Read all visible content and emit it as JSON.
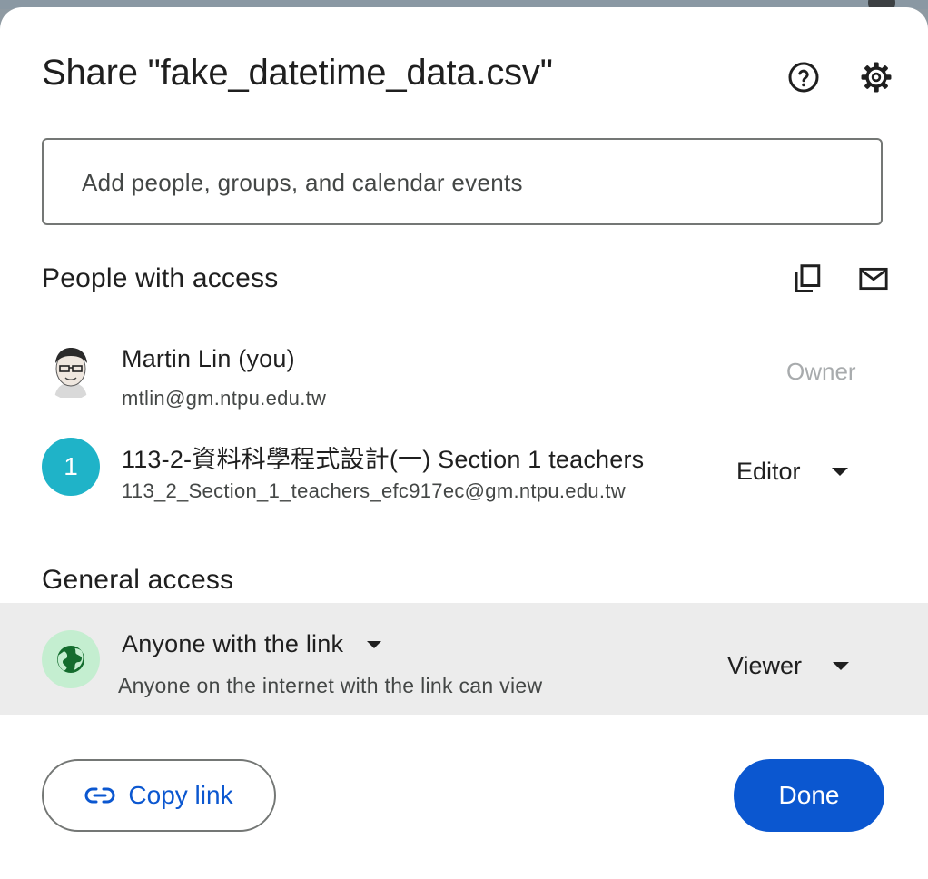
{
  "dialog": {
    "title": "Share \"fake_datetime_data.csv\"",
    "help_icon": "help-circle-icon",
    "settings_icon": "gear-icon"
  },
  "add_people": {
    "placeholder": "Add people, groups, and calendar events"
  },
  "people_with_access": {
    "heading": "People with access",
    "copy_emails_icon": "copy-icon",
    "email_icon": "mail-icon",
    "people": [
      {
        "name": "Martin Lin (you)",
        "email": "mtlin@gm.ntpu.edu.tw",
        "role": "Owner",
        "avatar": "photo"
      },
      {
        "name": "113-2-資料科學程式設計(一) Section 1 teachers",
        "email": "113_2_Section_1_teachers_efc917ec@gm.ntpu.edu.tw",
        "role": "Editor",
        "avatar_letter": "1"
      }
    ]
  },
  "general_access": {
    "heading": "General access",
    "access_option": "Anyone with the link",
    "description": "Anyone on the internet with the link can view",
    "role": "Viewer",
    "icon": "globe-icon"
  },
  "footer": {
    "copy_link_label": "Copy link",
    "copy_link_icon": "link-icon",
    "done_label": "Done"
  },
  "colors": {
    "primary": "#0b57d0",
    "group_avatar": "#1fb3c8",
    "globe_bg": "#c4eed0",
    "globe_fg": "#146c2e",
    "highlight_row": "#ececec"
  }
}
